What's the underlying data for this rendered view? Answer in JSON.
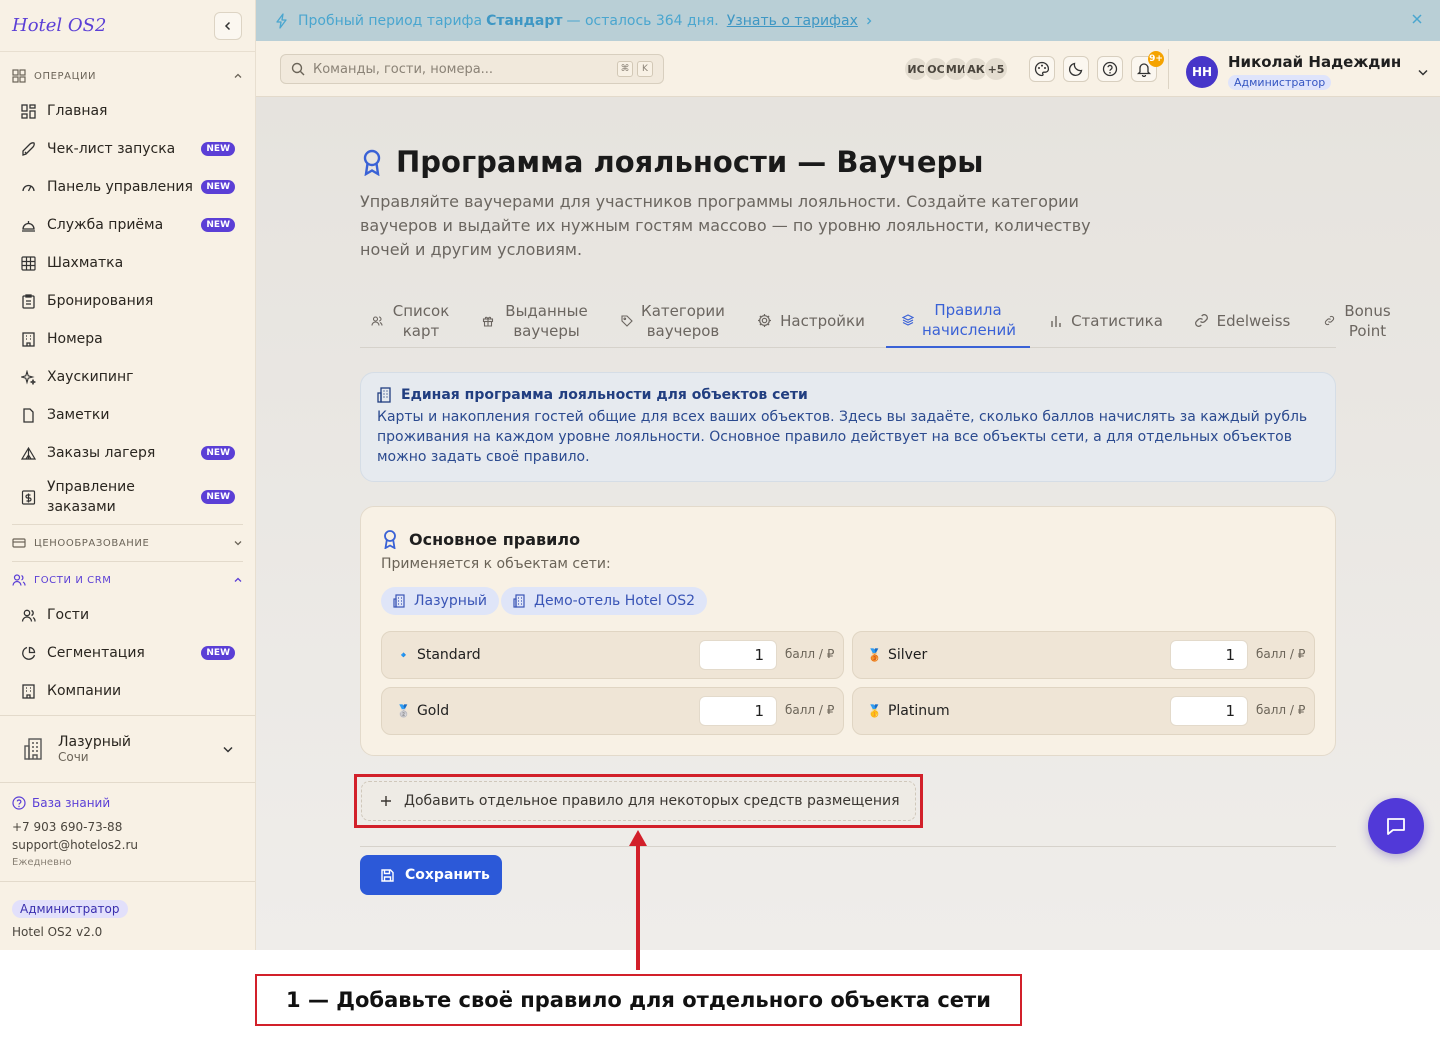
{
  "app": {
    "logo": "Hotel OS2"
  },
  "sidebar": {
    "sections": {
      "operations": "Операции",
      "pricing": "Ценообразование",
      "guests_crm": "Гости и CRM"
    },
    "items": [
      {
        "label": "Главная",
        "icon": "dashboard-grid-icon"
      },
      {
        "label": "Чек-лист запуска",
        "icon": "rocket-icon",
        "badge": "NEW"
      },
      {
        "label": "Панель управления",
        "icon": "gauge-icon",
        "badge": "NEW"
      },
      {
        "label": "Служба приёма",
        "icon": "bell-desk-icon",
        "badge": "NEW"
      },
      {
        "label": "Шахматка",
        "icon": "grid-icon"
      },
      {
        "label": "Бронирования",
        "icon": "clipboard-icon"
      },
      {
        "label": "Номера",
        "icon": "building-icon"
      },
      {
        "label": "Хаускипинг",
        "icon": "sparkles-icon"
      },
      {
        "label": "Заметки",
        "icon": "file-icon"
      },
      {
        "label": "Заказы лагеря",
        "icon": "tent-icon",
        "badge": "NEW"
      },
      {
        "label": "Управление заказами",
        "icon": "dollar-icon",
        "badge": "NEW"
      }
    ],
    "crm_items": [
      {
        "label": "Гости",
        "icon": "users-icon"
      },
      {
        "label": "Сегментация",
        "icon": "pie-icon",
        "badge": "NEW"
      },
      {
        "label": "Компании",
        "icon": "building-icon"
      }
    ],
    "hotel": {
      "name": "Лазурный",
      "city": "Сочи"
    },
    "support": {
      "kb": "База знаний",
      "phone": "+7 903 690-73-88",
      "email": "support@hotelos2.ru",
      "schedule": "Ежедневно"
    },
    "role": "Администратор",
    "version": "Hotel OS2 v2.0"
  },
  "banner": {
    "pre": "Пробный период тарифа",
    "plan": "Стандарт",
    "post": "— осталось 364 дня.",
    "link": "Узнать о тарифах"
  },
  "topbar": {
    "search_placeholder": "Команды, гости, номера...",
    "kbd": [
      "⌘",
      "K"
    ],
    "avatars": [
      "ИС",
      "ОС",
      "МИ",
      "АК",
      "+5"
    ],
    "notif_badge": "9+",
    "user": {
      "initials": "НН",
      "name": "Николай Надеждин",
      "role": "Администратор"
    }
  },
  "page": {
    "title": "Программа лояльности — Ваучеры",
    "lead": "Управляйте ваучерами для участников программы лояльности. Создайте категории ваучеров и выдайте их нужным гостям массово — по уровню лояльности, количеству ночей и другим условиям.",
    "tabs": [
      {
        "label": "Список карт"
      },
      {
        "label": "Выданные ваучеры"
      },
      {
        "label": "Категории ваучеров"
      },
      {
        "label": "Настройки"
      },
      {
        "label": "Правила начислений",
        "active": true
      },
      {
        "label": "Статистика"
      },
      {
        "label": "Edelweiss"
      },
      {
        "label": "Bonus Point"
      }
    ],
    "info": {
      "title": "Единая программа лояльности для объектов сети",
      "body": "Карты и накопления гостей общие для всех ваших объектов. Здесь вы задаёте, сколько баллов начислять за каждый рубль проживания на каждом уровне лояльности. Основное правило действует на все объекты сети, а для отдельных объектов можно задать своё правило."
    },
    "rule": {
      "title": "Основное правило",
      "subtitle": "Применяется к объектам сети:",
      "properties": [
        "Лазурный",
        "Демо-отель Hotel OS2"
      ],
      "tiers": [
        {
          "name": "Standard",
          "emoji": "🔹",
          "value": "1",
          "unit": "балл / ₽"
        },
        {
          "name": "Silver",
          "emoji": "🥉",
          "value": "1",
          "unit": "балл / ₽"
        },
        {
          "name": "Gold",
          "emoji": "🥈",
          "value": "1",
          "unit": "балл / ₽"
        },
        {
          "name": "Platinum",
          "emoji": "🥇",
          "value": "1",
          "unit": "балл / ₽"
        }
      ]
    },
    "add_rule": "Добавить отдельное правило для некоторых средств размещения",
    "save": "Сохранить"
  },
  "annotation": {
    "callout": "1 — Добавьте своё правило для отдельного объекта сети",
    "color": "#d2202a"
  }
}
